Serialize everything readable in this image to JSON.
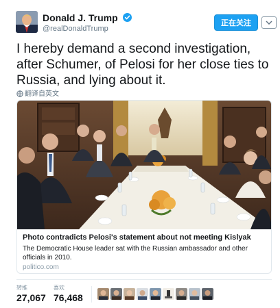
{
  "tweet": {
    "display_name": "Donald J. Trump",
    "handle": "@realDonaldTrump",
    "follow_label": "正在关注",
    "text": "I hereby demand a second investigation, after Schumer, of Pelosi for her close ties to Russia, and lying about it.",
    "translate_label": "翻译自英文"
  },
  "card": {
    "title": "Photo contradicts Pelosi's statement about not meeting Kislyak",
    "description": "The Democratic House leader sat with the Russian ambassador and other officials in 2010.",
    "domain": "politico.com"
  },
  "stats": {
    "retweets_label": "转推",
    "retweets_value": "27,067",
    "likes_label": "喜欢",
    "likes_value": "76,468"
  },
  "likers": [
    "avatar-1",
    "avatar-2",
    "avatar-3",
    "avatar-4",
    "avatar-5",
    "avatar-6",
    "avatar-7",
    "avatar-8",
    "avatar-9"
  ],
  "colors": {
    "accent": "#1da1f2",
    "text": "#14171a",
    "muted": "#657786"
  }
}
